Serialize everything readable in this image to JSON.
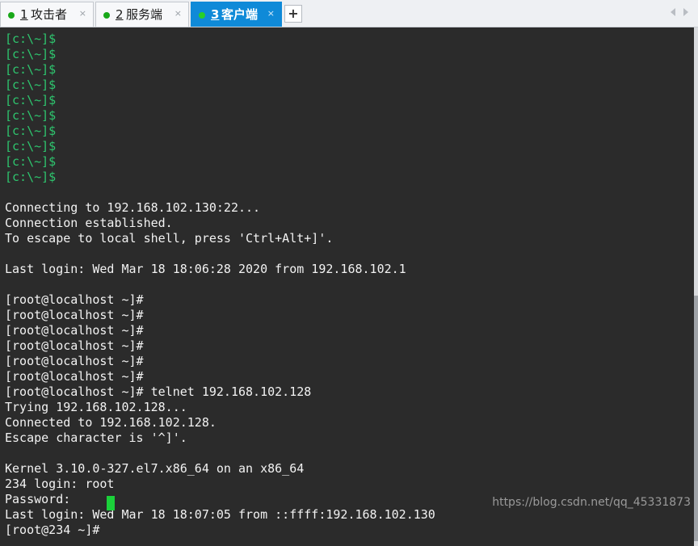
{
  "tabs": [
    {
      "number": "1",
      "label": "攻击者",
      "close": "×",
      "active": false
    },
    {
      "number": "2",
      "label": "服务端",
      "close": "×",
      "active": false
    },
    {
      "number": "3",
      "label": "客户端",
      "close": "×",
      "active": true
    }
  ],
  "add_tab_label": "+",
  "terminal": {
    "lines": [
      "[c:\\~]$",
      "[c:\\~]$",
      "[c:\\~]$",
      "[c:\\~]$",
      "[c:\\~]$",
      "[c:\\~]$",
      "[c:\\~]$",
      "[c:\\~]$",
      "[c:\\~]$",
      "[c:\\~]$",
      "",
      "Connecting to 192.168.102.130:22...",
      "Connection established.",
      "To escape to local shell, press 'Ctrl+Alt+]'.",
      "",
      "Last login: Wed Mar 18 18:06:28 2020 from 192.168.102.1",
      "",
      "[root@localhost ~]#",
      "[root@localhost ~]#",
      "[root@localhost ~]#",
      "[root@localhost ~]#",
      "[root@localhost ~]#",
      "[root@localhost ~]#",
      "[root@localhost ~]# telnet 192.168.102.128",
      "Trying 192.168.102.128...",
      "Connected to 192.168.102.128.",
      "Escape character is '^]'.",
      "",
      "Kernel 3.10.0-327.el7.x86_64 on an x86_64",
      "234 login: root",
      "Password:",
      "Last login: Wed Mar 18 18:07:05 from ::ffff:192.168.102.130",
      "[root@234 ~]#"
    ],
    "local_prompt_count": 10
  },
  "watermark": "https://blog.csdn.net/qq_45331873",
  "colors": {
    "terminal_bg": "#2b2b2b",
    "terminal_fg": "#f2f2f2",
    "local_prompt": "#2ec56e",
    "cursor": "#1bd13a",
    "active_tab": "#0f8ad8",
    "status_dot": "#19a819"
  },
  "icons": {
    "tab_status": "connected-dot-icon",
    "tab_close": "close-icon",
    "add_tab": "plus-icon",
    "scroll_left": "chevron-left-icon",
    "scroll_right": "chevron-right-icon"
  }
}
